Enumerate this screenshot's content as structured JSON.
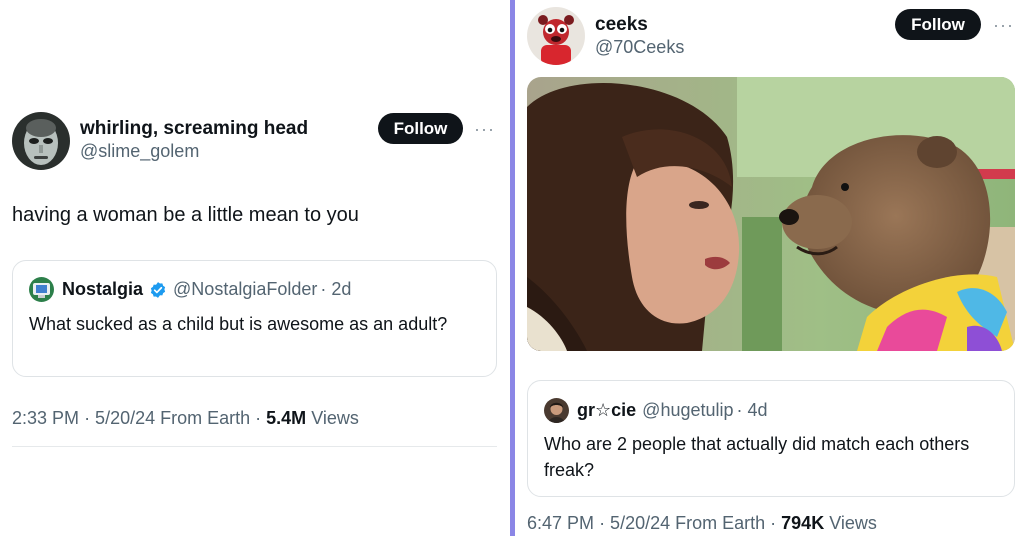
{
  "left_tweet": {
    "display_name": "whirling, screaming head",
    "handle": "@slime_golem",
    "follow_label": "Follow",
    "more_label": "···",
    "text": "having a woman be a little mean to you",
    "quote": {
      "display_name": "Nostalgia",
      "handle": "@NostalgiaFolder",
      "age": "· 2d",
      "text": "What sucked as a child but is awesome as an adult?"
    },
    "meta": {
      "time": "2:33 PM",
      "date": "· 5/20/24 From Earth ·",
      "views_count": "5.4M",
      "views_label": "Views"
    }
  },
  "right_tweet": {
    "display_name": "ceeks",
    "handle": "@70Ceeks",
    "follow_label": "Follow",
    "more_label": "···",
    "quote": {
      "display_name": "gr☆cie",
      "handle": "@hugetulip",
      "age": "· 4d",
      "text": "Who are 2 people that actually did match each others freak?"
    },
    "meta": {
      "time": "6:47 PM",
      "date": "· 5/20/24 From Earth ·",
      "views_count": "794K",
      "views_label": "Views"
    }
  },
  "colors": {
    "divider": "#8b86e6",
    "verified": "#1d9bf0",
    "follow_bg": "#0f1419",
    "muted_text": "#536471"
  },
  "icons": [
    "verified-badge-icon",
    "more-options-icon"
  ]
}
